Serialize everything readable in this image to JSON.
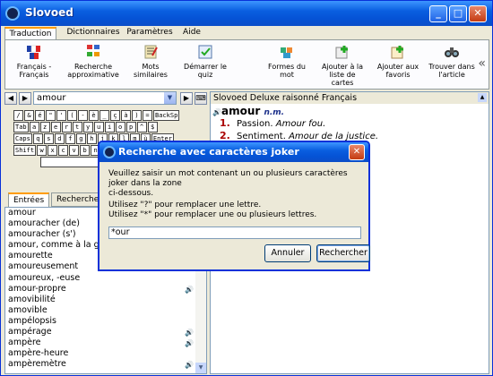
{
  "window": {
    "title": "Slovoed"
  },
  "tabs": [
    {
      "label": "Traduction"
    },
    {
      "label": "Dictionnaires"
    },
    {
      "label": "Paramètres"
    },
    {
      "label": "Aide"
    }
  ],
  "toolbar": [
    {
      "line1": "Français -",
      "line2": "Français",
      "icon": "flag-swap-icon"
    },
    {
      "line1": "Recherche",
      "line2": "approximative",
      "icon": "fuzzy-search-icon"
    },
    {
      "line1": "Mots similaires",
      "line2": "",
      "icon": "similar-words-icon"
    },
    {
      "line1": "Démarrer le",
      "line2": "quiz",
      "icon": "quiz-icon"
    },
    {
      "line1": "Formes du mot",
      "line2": "",
      "icon": "word-forms-icon"
    },
    {
      "line1": "Ajouter à la",
      "line2": "liste de cartes",
      "icon": "add-card-icon"
    },
    {
      "line1": "Ajouter aux",
      "line2": "favoris",
      "icon": "add-favorite-icon"
    },
    {
      "line1": "Trouver dans",
      "line2": "l'article",
      "icon": "binoculars-icon"
    }
  ],
  "ribbon_more": "«",
  "search": {
    "value": "amour"
  },
  "keyboard": {
    "row1": [
      "/",
      "&",
      "é",
      "\"",
      "'",
      "(",
      "-",
      "è",
      "_",
      "ç",
      "à",
      ")",
      "=",
      "BackSp"
    ],
    "row2": [
      "Tab",
      "a",
      "z",
      "e",
      "r",
      "t",
      "y",
      "u",
      "i",
      "o",
      "p",
      "^",
      "$"
    ],
    "row3": [
      "Caps",
      "q",
      "s",
      "d",
      "f",
      "g",
      "h",
      "j",
      "k",
      "l",
      "m",
      "ù",
      "Enter"
    ],
    "row4": [
      "Shift",
      "w",
      "x",
      "c",
      "v",
      "b",
      "n",
      ",",
      ";",
      ":",
      "!"
    ]
  },
  "left_tabs": [
    {
      "label": "Entrées"
    },
    {
      "label": "Rechercher"
    }
  ],
  "word_list": [
    {
      "text": "amour",
      "audio": false
    },
    {
      "text": "amouracher (de)",
      "audio": false
    },
    {
      "text": "amouracher (s')",
      "audio": false
    },
    {
      "text": "amour, comme à la g",
      "audio": false
    },
    {
      "text": "amourette",
      "audio": false
    },
    {
      "text": "amoureusement",
      "audio": false
    },
    {
      "text": "amoureux, -euse",
      "audio": false
    },
    {
      "text": "amour-propre",
      "audio": true
    },
    {
      "text": "amovibilité",
      "audio": false
    },
    {
      "text": "amovible",
      "audio": false
    },
    {
      "text": "ampélopsis",
      "audio": false
    },
    {
      "text": "ampérage",
      "audio": true
    },
    {
      "text": "ampère",
      "audio": true
    },
    {
      "text": "ampère-heure",
      "audio": false
    },
    {
      "text": "ampèremètre",
      "audio": true
    }
  ],
  "article": {
    "header": "Slovoed Deluxe raisonné Français",
    "headword": "amour",
    "pos": "n.m.",
    "senses": [
      {
        "num": "1.",
        "text": "Passion.",
        "example": "Amour fou."
      },
      {
        "num": "2.",
        "text": "Sentiment.",
        "example": "Amour de la justice."
      }
    ]
  },
  "dialog": {
    "title": "Recherche avec caractères joker",
    "line1": "Veuillez saisir un mot contenant un ou plusieurs caractères joker dans la zone",
    "line2": "ci-dessous.",
    "line3": "Utilisez \"?\" pour remplacer une lettre.",
    "line4": "Utilisez \"*\" pour remplacer une ou plusieurs lettres.",
    "input_value": "*our",
    "cancel_label": "Annuler",
    "search_label": "Rechercher"
  },
  "colors": {
    "title_bar": "#0a5fe0",
    "sense_number": "#aa0000",
    "tab_accent": "#ff9c00"
  }
}
